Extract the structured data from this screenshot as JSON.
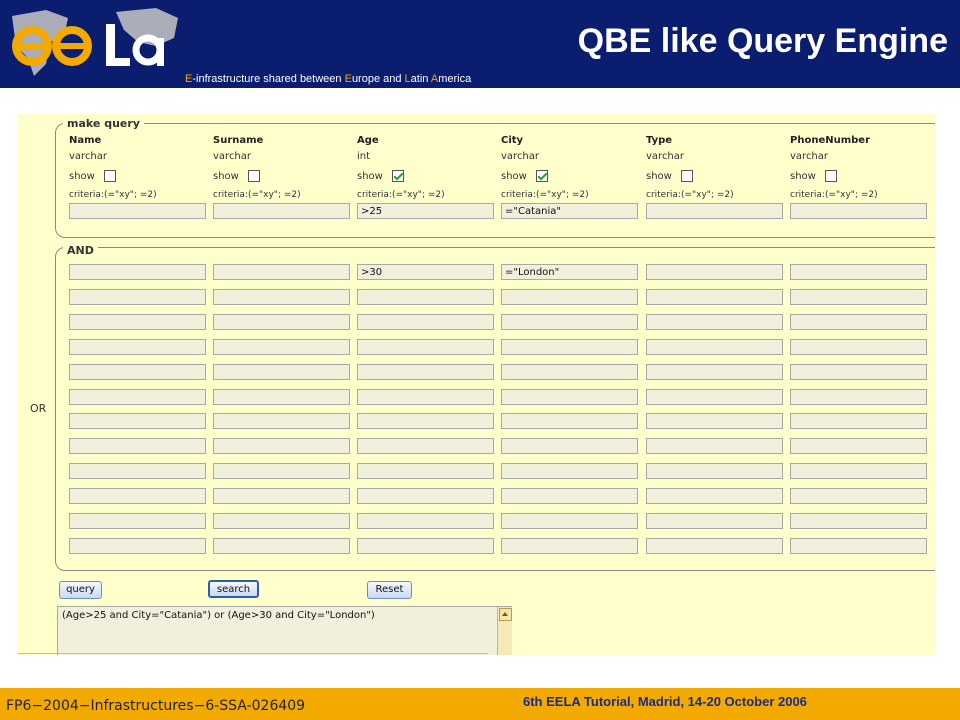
{
  "header": {
    "title": "QBE like Query Engine",
    "tagline": [
      {
        "text": "E",
        "orange": true
      },
      {
        "text": "-infrastructure shared between ",
        "orange": false
      },
      {
        "text": "E",
        "orange": true
      },
      {
        "text": "urope and ",
        "orange": false
      },
      {
        "text": "L",
        "orange": true
      },
      {
        "text": "atin ",
        "orange": false
      },
      {
        "text": "A",
        "orange": true
      },
      {
        "text": "merica",
        "orange": false
      }
    ],
    "logo": {
      "icon": "eela-logo",
      "letters": "ee La"
    }
  },
  "query_form": {
    "make_query_legend": "make query",
    "and_legend": "AND",
    "or_label": "OR",
    "show_label": "show",
    "criteria_label": "criteria:(=\"xy\"; =2)",
    "columns": [
      {
        "name": "Name",
        "type": "varchar",
        "show": false,
        "criteria": ""
      },
      {
        "name": "Surname",
        "type": "varchar",
        "show": false,
        "criteria": ""
      },
      {
        "name": "Age",
        "type": "int",
        "show": true,
        "criteria": ">25"
      },
      {
        "name": "City",
        "type": "varchar",
        "show": true,
        "criteria": "=\"Catania\""
      },
      {
        "name": "Type",
        "type": "varchar",
        "show": false,
        "criteria": ""
      },
      {
        "name": "PhoneNumber",
        "type": "varchar",
        "show": false,
        "criteria": ""
      }
    ],
    "or_rows": [
      [
        "",
        "",
        ">30",
        "=\"London\"",
        "",
        ""
      ],
      [
        "",
        "",
        "",
        "",
        "",
        ""
      ],
      [
        "",
        "",
        "",
        "",
        "",
        ""
      ],
      [
        "",
        "",
        "",
        "",
        "",
        ""
      ],
      [
        "",
        "",
        "",
        "",
        "",
        ""
      ],
      [
        "",
        "",
        "",
        "",
        "",
        ""
      ],
      [
        "",
        "",
        "",
        "",
        "",
        ""
      ],
      [
        "",
        "",
        "",
        "",
        "",
        ""
      ],
      [
        "",
        "",
        "",
        "",
        "",
        ""
      ],
      [
        "",
        "",
        "",
        "",
        "",
        ""
      ],
      [
        "",
        "",
        "",
        "",
        "",
        ""
      ],
      [
        "",
        "",
        "",
        "",
        "",
        ""
      ]
    ]
  },
  "buttons": {
    "query": "query",
    "search": "search",
    "reset": "Reset"
  },
  "result_text": "(Age>25 and City=\"Catania\") or (Age>30 and City=\"London\")",
  "footer": {
    "left": "FP6−2004−Infrastructures−6-SSA-026409",
    "right": "6th EELA Tutorial, Madrid, 14-20 October 2006"
  },
  "colors": {
    "header_bg": "#0b1d6e",
    "footer_bg": "#f2a900",
    "panel_bg": "#ffffcc",
    "checkbox_check": "#2a9d2a"
  }
}
